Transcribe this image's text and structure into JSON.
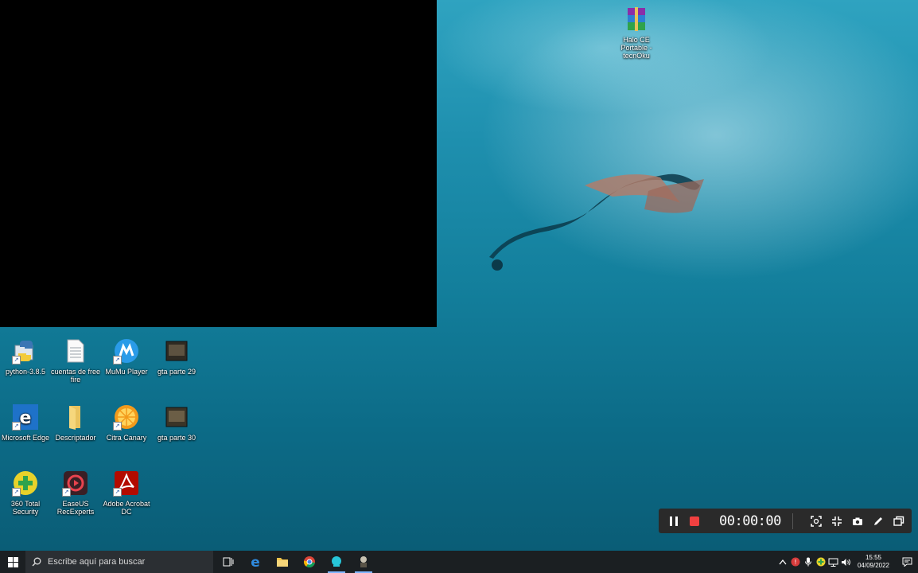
{
  "desktop": {
    "top_icon": {
      "label": "Halo CE Portable - tecnOku",
      "icon": "winrar-archive-icon"
    },
    "icons": [
      {
        "label": "python-3.8.5",
        "icon": "python-installer-icon"
      },
      {
        "label": "cuentas de free fire",
        "icon": "text-document-icon"
      },
      {
        "label": "MuMu Player",
        "icon": "mumu-player-icon"
      },
      {
        "label": "gta parte 29",
        "icon": "video-thumbnail-icon"
      },
      {
        "label": "Microsoft Edge",
        "icon": "edge-icon"
      },
      {
        "label": "Descriptador",
        "icon": "folder-icon"
      },
      {
        "label": "Citra Canary",
        "icon": "citra-icon"
      },
      {
        "label": "gta parte 30",
        "icon": "video-thumbnail-icon"
      },
      {
        "label": "360 Total Security",
        "icon": "360-security-icon"
      },
      {
        "label": "EaseUS RecExperts",
        "icon": "recexperts-icon"
      },
      {
        "label": "Adobe Acrobat DC",
        "icon": "acrobat-icon"
      }
    ]
  },
  "recorder": {
    "time": "00:00:00",
    "buttons": [
      "pause-icon",
      "stop-icon",
      "screenshot-region-icon",
      "minimize-icon",
      "camera-icon",
      "pen-icon",
      "window-icon"
    ]
  },
  "taskbar": {
    "search_placeholder": "Escribe aquí para buscar",
    "clock_time": "15:55",
    "clock_date": "04/09/2022"
  }
}
